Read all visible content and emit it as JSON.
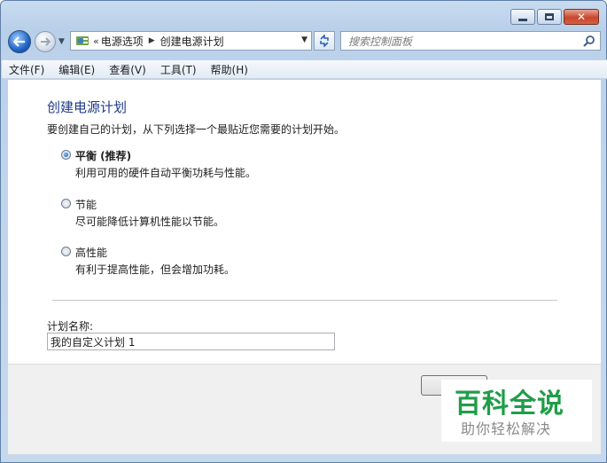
{
  "window": {
    "minimize_label": "minimize",
    "maximize_label": "maximize",
    "close_label": "close"
  },
  "nav": {
    "chevron": "«",
    "breadcrumbs": [
      "电源选项",
      "创建电源计划"
    ],
    "search_placeholder": "搜索控制面板"
  },
  "menu": [
    {
      "label": "文件(F)"
    },
    {
      "label": "编辑(E)"
    },
    {
      "label": "查看(V)"
    },
    {
      "label": "工具(T)"
    },
    {
      "label": "帮助(H)"
    }
  ],
  "page": {
    "title": "创建电源计划",
    "description": "要创建自己的计划，从下列选择一个最贴近您需要的计划开始。",
    "options": [
      {
        "label": "平衡 (推荐)",
        "description": "利用可用的硬件自动平衡功耗与性能。",
        "selected": true
      },
      {
        "label": "节能",
        "description": "尽可能降低计算机性能以节能。",
        "selected": false
      },
      {
        "label": "高性能",
        "description": "有利于提高性能，但会增加功耗。",
        "selected": false
      }
    ],
    "plan_name_label": "计划名称:",
    "plan_name_value": "我的自定义计划 1"
  },
  "watermark": {
    "main": "百科全说",
    "sub": "助你轻松解决"
  },
  "colors": {
    "title_blue": "#1e3a8a",
    "watermark_green": "#1f9d48",
    "close_red": "#c8462d"
  }
}
